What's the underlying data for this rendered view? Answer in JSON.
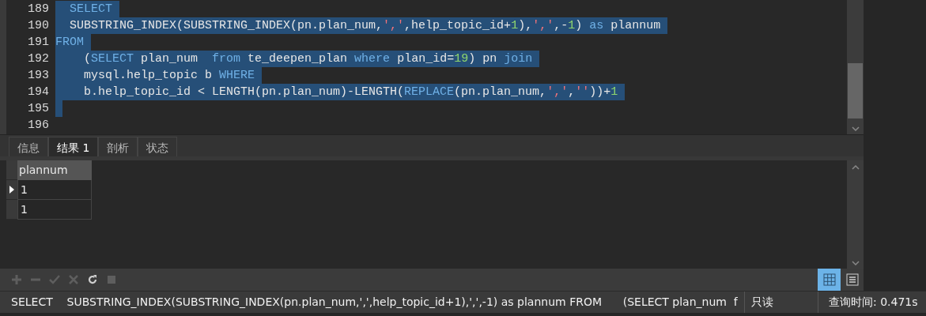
{
  "editor": {
    "lines": [
      {
        "number": "189",
        "selected": true,
        "tokens": [
          {
            "kind": "keyword",
            "text": "  SELECT"
          }
        ]
      },
      {
        "number": "190",
        "selected": true,
        "tokens": [
          {
            "kind": "plain",
            "text": "  SUBSTRING_INDEX(SUBSTRING_INDEX(pn.plan_num,"
          },
          {
            "kind": "string",
            "text": "','"
          },
          {
            "kind": "plain",
            "text": ",help_topic_id+"
          },
          {
            "kind": "number",
            "text": "1"
          },
          {
            "kind": "plain",
            "text": "),"
          },
          {
            "kind": "string",
            "text": "','"
          },
          {
            "kind": "plain",
            "text": ",-"
          },
          {
            "kind": "number",
            "text": "1"
          },
          {
            "kind": "plain",
            "text": ") "
          },
          {
            "kind": "keyword",
            "text": "as"
          },
          {
            "kind": "plain",
            "text": " plannum"
          }
        ]
      },
      {
        "number": "191",
        "selected": true,
        "tokens": [
          {
            "kind": "keyword",
            "text": "FROM"
          }
        ]
      },
      {
        "number": "192",
        "selected": true,
        "tokens": [
          {
            "kind": "plain",
            "text": "    ("
          },
          {
            "kind": "keyword",
            "text": "SELECT"
          },
          {
            "kind": "plain",
            "text": " plan_num  "
          },
          {
            "kind": "keyword",
            "text": "from"
          },
          {
            "kind": "plain",
            "text": " te_deepen_plan "
          },
          {
            "kind": "keyword",
            "text": "where"
          },
          {
            "kind": "plain",
            "text": " plan_id="
          },
          {
            "kind": "number",
            "text": "19"
          },
          {
            "kind": "plain",
            "text": ") pn "
          },
          {
            "kind": "keyword",
            "text": "join"
          }
        ]
      },
      {
        "number": "193",
        "selected": true,
        "tokens": [
          {
            "kind": "plain",
            "text": "    mysql.help_topic b "
          },
          {
            "kind": "keyword",
            "text": "WHERE"
          }
        ]
      },
      {
        "number": "194",
        "selected": true,
        "tokens": [
          {
            "kind": "plain",
            "text": "    b.help_topic_id < LENGTH(pn.plan_num)-LENGTH("
          },
          {
            "kind": "keyword",
            "text": "REPLACE"
          },
          {
            "kind": "plain",
            "text": "(pn.plan_num,"
          },
          {
            "kind": "string",
            "text": "','"
          },
          {
            "kind": "plain",
            "text": ","
          },
          {
            "kind": "string",
            "text": "''"
          },
          {
            "kind": "plain",
            "text": "))+"
          },
          {
            "kind": "number",
            "text": "1"
          }
        ]
      },
      {
        "number": "195",
        "selected": true
      },
      {
        "number": "196",
        "selected": false
      }
    ]
  },
  "tabs": [
    {
      "label": "信息",
      "selected": false
    },
    {
      "label": "结果 1",
      "selected": true
    },
    {
      "label": "剖析",
      "selected": false
    },
    {
      "label": "状态",
      "selected": false
    }
  ],
  "grid": {
    "columns": [
      "plannum"
    ],
    "rows": [
      {
        "cells": [
          "1"
        ],
        "current": true
      },
      {
        "cells": [
          "1"
        ],
        "current": false
      }
    ]
  },
  "toolbar": {
    "actions": [
      {
        "kind": "add",
        "disabled": true
      },
      {
        "kind": "remove",
        "disabled": true
      },
      {
        "kind": "apply",
        "disabled": true
      },
      {
        "kind": "cancel",
        "disabled": true
      },
      {
        "kind": "refresh",
        "disabled": false
      },
      {
        "kind": "stop",
        "disabled": true
      }
    ],
    "views": [
      {
        "kind": "grid",
        "selected": true
      },
      {
        "kind": "form",
        "selected": false
      }
    ]
  },
  "status_bar": {
    "sql": "SELECT    SUBSTRING_INDEX(SUBSTRING_INDEX(pn.plan_num,',',help_topic_id+1),',',-1) as plannum FROM      (SELECT plan_num  f",
    "mode": "只读",
    "query_time": "查询时间: 0.471s"
  }
}
